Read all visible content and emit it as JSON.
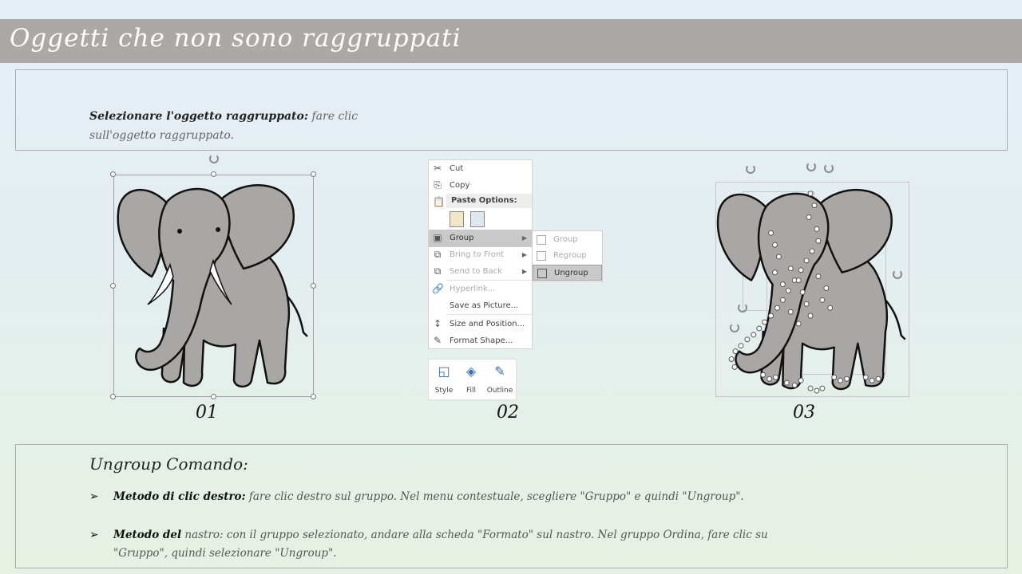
{
  "slide": {
    "title": "Oggetti che non sono raggruppati"
  },
  "intro": {
    "bold": "Selezionare l'oggetto raggruppato:",
    "text": " fare clic sull'oggetto raggruppato."
  },
  "steps": [
    "01",
    "02",
    "03"
  ],
  "context_menu": {
    "cut": "Cut",
    "copy": "Copy",
    "paste_options": "Paste Options:",
    "group": "Group",
    "bring_to_front": "Bring to Front",
    "send_to_back": "Send to Back",
    "hyperlink": "Hyperlink...",
    "save_as_picture": "Save as Picture...",
    "size_and_position": "Size and Position...",
    "format_shape": "Format Shape..."
  },
  "submenu": {
    "group": "Group",
    "regroup": "Regroup",
    "ungroup": "Ungroup"
  },
  "mini_toolbar": {
    "style": "Style",
    "fill": "Fill",
    "outline": "Outline"
  },
  "ungroup_section": {
    "title": "Ungroup Comando:",
    "bullet1_bold": "Metodo di clic destro:",
    "bullet1_text": " fare clic destro sul gruppo. Nel menu contestuale, scegliere \"Gruppo\" e quindi \"Ungroup\".",
    "bullet2_bold": "Metodo del",
    "bullet2_text": " nastro: con il gruppo selezionato, andare alla scheda \"Formato\" sul nastro. Nel gruppo Ordina, fare clic su \"Gruppo\", quindi selezionare \"Ungroup\"."
  },
  "colors": {
    "title_bar": "#aca8a6",
    "elephant_fill": "#a9a6a6",
    "menu_highlight": "#c9c9c9"
  }
}
